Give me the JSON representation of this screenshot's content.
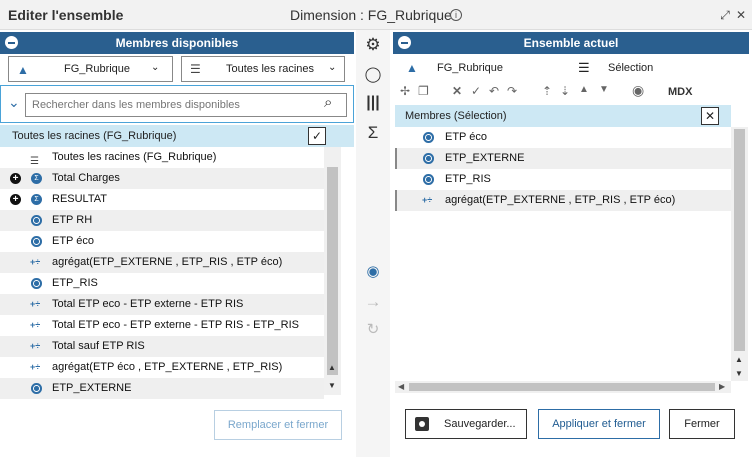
{
  "window": {
    "title": "Editer l'ensemble",
    "dimension_label": "Dimension : FG_Rubrique",
    "info": "i"
  },
  "left": {
    "header": "Membres disponibles",
    "dim_dropdown": "FG_Rubrique",
    "roots_dropdown": "Toutes les racines",
    "search_placeholder": "Rechercher dans les membres disponibles",
    "group_title": "Toutes les racines (FG_Rubrique)",
    "rows": [
      {
        "label": "Toutes les racines (FG_Rubrique)",
        "icon": "hierarchy-icon"
      },
      {
        "label": "Total Charges",
        "icon": "sigma-icon",
        "expand": true
      },
      {
        "label": "RESULTAT",
        "icon": "sigma-icon",
        "expand": true
      },
      {
        "label": "ETP RH",
        "icon": "member-icon"
      },
      {
        "label": "ETP éco",
        "icon": "member-icon"
      },
      {
        "label": "agrégat(ETP_EXTERNE , ETP_RIS , ETP éco)",
        "icon": "calc-icon"
      },
      {
        "label": "ETP_RIS",
        "icon": "member-icon"
      },
      {
        "label": "Total ETP eco - ETP externe - ETP RIS",
        "icon": "calc-icon"
      },
      {
        "label": "Total ETP eco - ETP externe - ETP RIS - ETP_RIS",
        "icon": "calc-icon"
      },
      {
        "label": "Total sauf ETP RIS",
        "icon": "calc-icon"
      },
      {
        "label": "agrégat(ETP éco , ETP_EXTERNE , ETP_RIS)",
        "icon": "calc-icon"
      },
      {
        "label": "ETP_EXTERNE",
        "icon": "member-icon"
      }
    ],
    "replace_button": "Remplacer et fermer"
  },
  "right": {
    "header": "Ensemble actuel",
    "dim_label": "FG_Rubrique",
    "selection_label": "Sélection",
    "mdx_label": "MDX",
    "group_title": "Membres (Sélection)",
    "rows": [
      {
        "label": "ETP éco",
        "icon": "member-icon"
      },
      {
        "label": "ETP_EXTERNE",
        "icon": "member-icon"
      },
      {
        "label": "ETP_RIS",
        "icon": "member-icon"
      },
      {
        "label": "agrégat(ETP_EXTERNE , ETP_RIS , ETP éco)",
        "icon": "calc-icon"
      }
    ],
    "save_button": "Sauvegarder...",
    "apply_button": "Appliquer et fermer",
    "close_button": "Fermer"
  },
  "colors": {
    "accent": "#2a5f8f",
    "selected_row": "#cde8f4",
    "primary_button_border": "#2d6da6"
  }
}
